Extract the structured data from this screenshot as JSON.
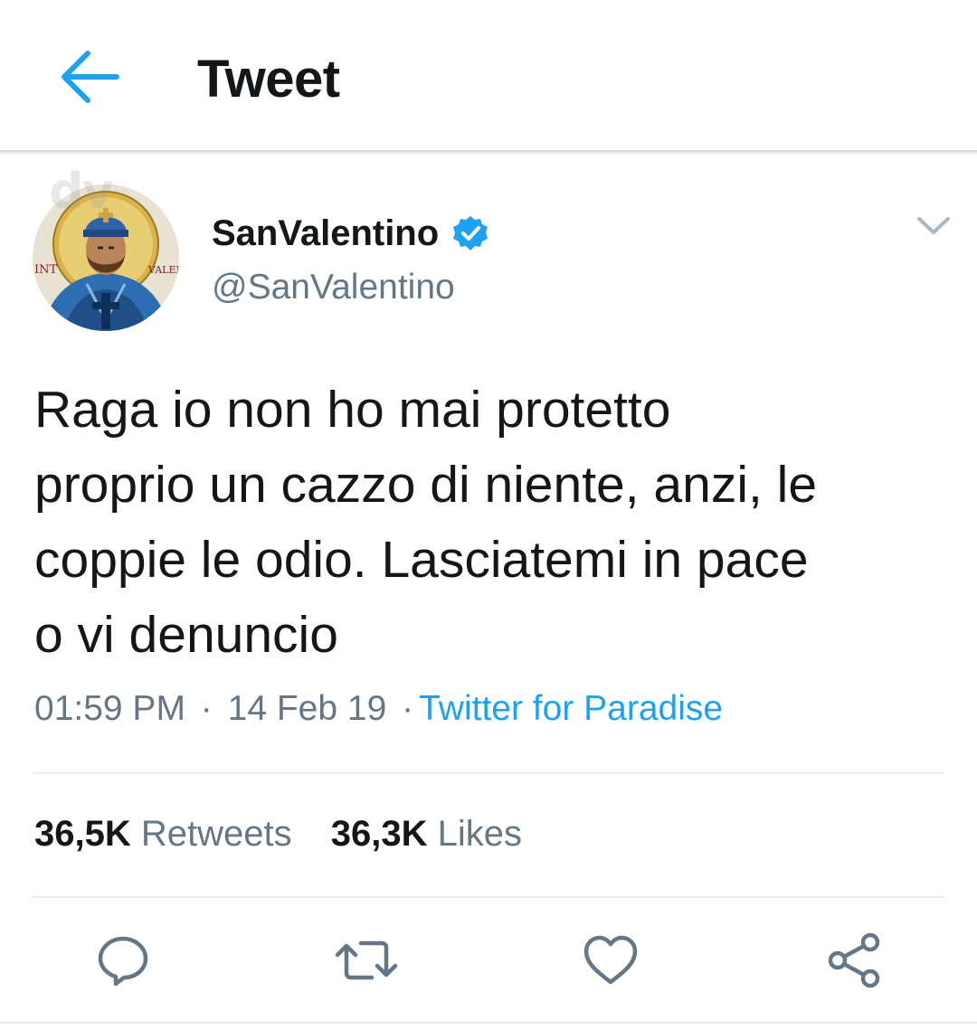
{
  "header": {
    "title": "Tweet",
    "back_icon": "back-arrow-icon",
    "accent_color": "#1da1f2"
  },
  "author": {
    "display_name": "SanValentino",
    "handle": "@SanValentino",
    "verified": true,
    "avatar_icon": "saint-valentine-icon",
    "avatar_watermark": "dv",
    "avatar_lettering": [
      "INT",
      "VALEN"
    ]
  },
  "tweet": {
    "text": "Raga io non ho mai protetto\nproprio un cazzo di niente, anzi, le\ncoppie le odio. Lasciatemi in pace\no vi denuncio",
    "time": "01:59 PM",
    "separator": "·",
    "date": "14 Feb 19",
    "source": "Twitter for Paradise"
  },
  "stats": {
    "retweets_count": "36,5K",
    "retweets_label": "Retweets",
    "likes_count": "36,3K",
    "likes_label": "Likes"
  },
  "actions": {
    "reply_icon": "reply-icon",
    "retweet_icon": "retweet-icon",
    "like_icon": "heart-icon",
    "share_icon": "share-icon"
  },
  "colors": {
    "text_primary": "#14171a",
    "text_secondary": "#657786",
    "link": "#1da1f2",
    "divider": "#e6ecf0"
  }
}
